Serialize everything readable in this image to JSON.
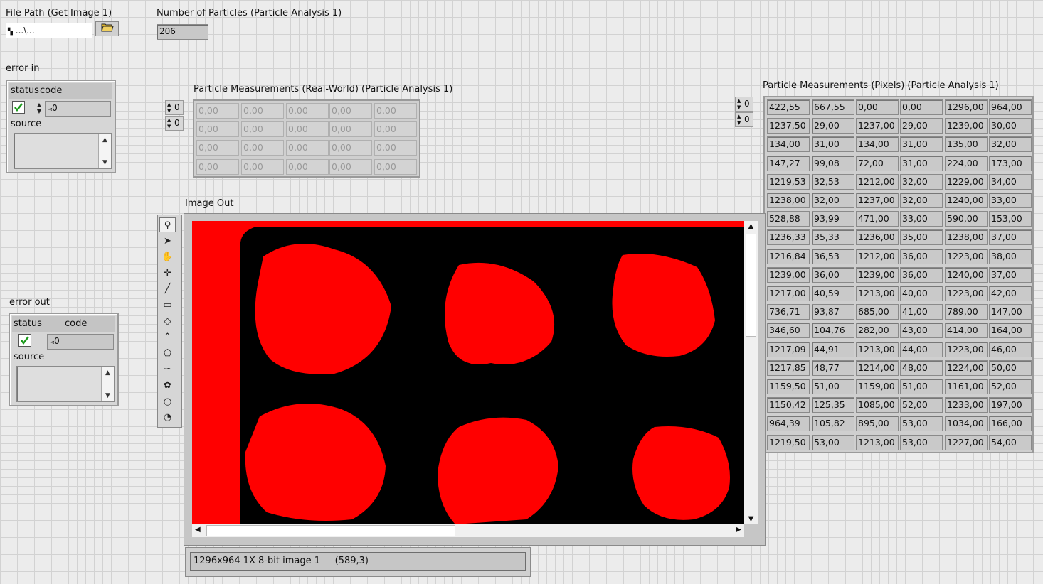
{
  "file_path": {
    "label": "File Path (Get Image 1)",
    "value": "...\\..."
  },
  "num_particles": {
    "label": "Number of Particles (Particle Analysis 1)",
    "value": "206"
  },
  "error_in": {
    "label": "error in",
    "status_label": "status",
    "code_label": "code",
    "code_value": "0",
    "source_label": "source"
  },
  "error_out": {
    "label": "error out",
    "status_label": "status",
    "code_label": "code",
    "code_value": "0",
    "source_label": "source"
  },
  "real_world": {
    "label": "Particle Measurements (Real-World) (Particle Analysis 1)",
    "index_row": "0",
    "index_col": "0",
    "rows": [
      [
        "0,00",
        "0,00",
        "0,00",
        "0,00",
        "0,00"
      ],
      [
        "0,00",
        "0,00",
        "0,00",
        "0,00",
        "0,00"
      ],
      [
        "0,00",
        "0,00",
        "0,00",
        "0,00",
        "0,00"
      ],
      [
        "0,00",
        "0,00",
        "0,00",
        "0,00",
        "0,00"
      ]
    ]
  },
  "pixels": {
    "label": "Particle Measurements (Pixels) (Particle Analysis 1)",
    "index_row": "0",
    "index_col": "0",
    "rows": [
      [
        "422,55",
        "667,55",
        "0,00",
        "0,00",
        "1296,00",
        "964,00"
      ],
      [
        "1237,50",
        "29,00",
        "1237,00",
        "29,00",
        "1239,00",
        "30,00"
      ],
      [
        "134,00",
        "31,00",
        "134,00",
        "31,00",
        "135,00",
        "32,00"
      ],
      [
        "147,27",
        "99,08",
        "72,00",
        "31,00",
        "224,00",
        "173,00"
      ],
      [
        "1219,53",
        "32,53",
        "1212,00",
        "32,00",
        "1229,00",
        "34,00"
      ],
      [
        "1238,00",
        "32,00",
        "1237,00",
        "32,00",
        "1240,00",
        "33,00"
      ],
      [
        "528,88",
        "93,99",
        "471,00",
        "33,00",
        "590,00",
        "153,00"
      ],
      [
        "1236,33",
        "35,33",
        "1236,00",
        "35,00",
        "1238,00",
        "37,00"
      ],
      [
        "1216,84",
        "36,53",
        "1212,00",
        "36,00",
        "1223,00",
        "38,00"
      ],
      [
        "1239,00",
        "36,00",
        "1239,00",
        "36,00",
        "1240,00",
        "37,00"
      ],
      [
        "1217,00",
        "40,59",
        "1213,00",
        "40,00",
        "1223,00",
        "42,00"
      ],
      [
        "736,71",
        "93,87",
        "685,00",
        "41,00",
        "789,00",
        "147,00"
      ],
      [
        "346,60",
        "104,76",
        "282,00",
        "43,00",
        "414,00",
        "164,00"
      ],
      [
        "1217,09",
        "44,91",
        "1213,00",
        "44,00",
        "1223,00",
        "46,00"
      ],
      [
        "1217,85",
        "48,77",
        "1214,00",
        "48,00",
        "1224,00",
        "50,00"
      ],
      [
        "1159,50",
        "51,00",
        "1159,00",
        "51,00",
        "1161,00",
        "52,00"
      ],
      [
        "1150,42",
        "125,35",
        "1085,00",
        "52,00",
        "1233,00",
        "197,00"
      ],
      [
        "964,39",
        "105,82",
        "895,00",
        "53,00",
        "1034,00",
        "166,00"
      ],
      [
        "1219,50",
        "53,00",
        "1213,00",
        "53,00",
        "1227,00",
        "54,00"
      ]
    ]
  },
  "image_out": {
    "label": "Image Out",
    "status_text": "1296x964 1X 8-bit image 1     (589,3)",
    "tools": [
      "zoom-icon",
      "pointer-icon",
      "pan-icon",
      "point-icon",
      "line-icon",
      "rectangle-icon",
      "rotated-rect-icon",
      "polyline-icon",
      "polygon-icon",
      "freehand-icon",
      "freehand-region-icon",
      "oval-icon",
      "annulus-icon"
    ]
  },
  "colors": {
    "particle": "#ff0000",
    "background": "#000000",
    "panel": "#c6c6c6"
  }
}
